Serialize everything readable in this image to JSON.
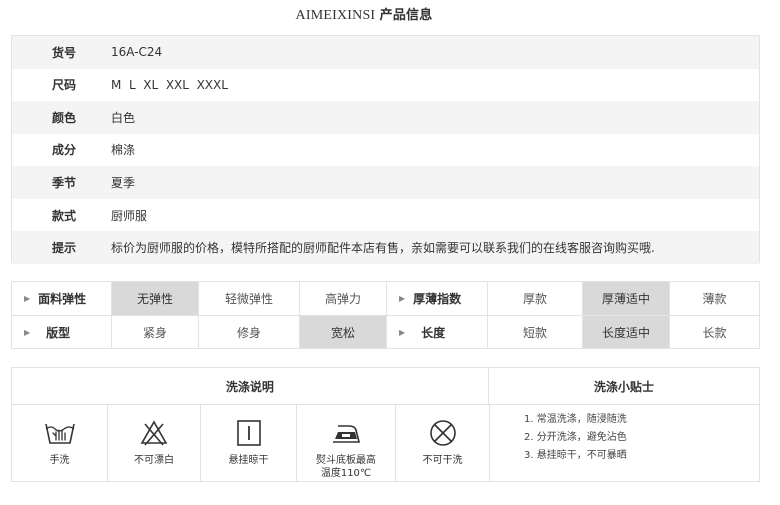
{
  "title": {
    "brand": "AIMEIXINSI",
    "suffix": "产品信息"
  },
  "info": [
    {
      "key": "货号",
      "value": "16A-C24"
    },
    {
      "key": "尺码",
      "value": "M  L  XL  XXL  XXXL"
    },
    {
      "key": "颜色",
      "value": "白色"
    },
    {
      "key": "成分",
      "value": "棉涤"
    },
    {
      "key": "季节",
      "value": "夏季"
    },
    {
      "key": "款式",
      "value": "厨师服"
    },
    {
      "key": "提示",
      "value": "标价为厨师服的价格，模特所搭配的厨师配件本店有售，亲如需要可以联系我们的在线客服咨询购买哦."
    }
  ],
  "attrs": {
    "elasticity": {
      "label": "面料弹性",
      "options": [
        "无弹性",
        "轻微弹性",
        "高弹力"
      ],
      "selected": 0
    },
    "thickness": {
      "label": "厚薄指数",
      "options": [
        "厚款",
        "厚薄适中",
        "薄款"
      ],
      "selected": 1
    },
    "fit": {
      "label": "版型",
      "options": [
        "紧身",
        "修身",
        "宽松"
      ],
      "selected": 2
    },
    "length": {
      "label": "长度",
      "options": [
        "短款",
        "长度适中",
        "长款"
      ],
      "selected": 1
    }
  },
  "wash": {
    "heading": "洗涤说明",
    "tips_heading": "洗涤小贴士",
    "icons": [
      {
        "name": "hand-wash-icon",
        "label": "手洗"
      },
      {
        "name": "no-bleach-icon",
        "label": "不可漂白"
      },
      {
        "name": "hang-dry-icon",
        "label": "悬挂晾干"
      },
      {
        "name": "iron-icon",
        "label_line1": "熨斗底板最高",
        "label_line2": "温度110℃"
      },
      {
        "name": "no-dry-clean-icon",
        "label": "不可干洗"
      }
    ],
    "tips": [
      "1. 常温洗涤，随浸随洗",
      "2. 分开洗涤，避免沾色",
      "3. 悬挂晾干，不可暴晒"
    ]
  }
}
